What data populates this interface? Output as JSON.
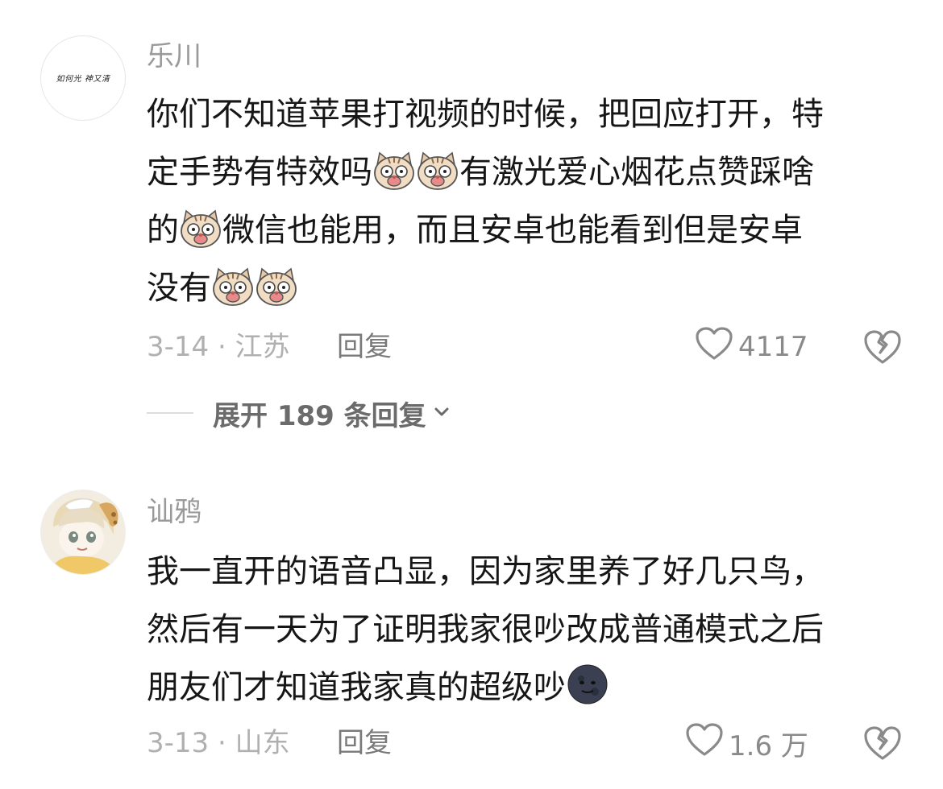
{
  "comments": [
    {
      "username": "乐川",
      "avatar_text": "如何光 神又清",
      "lines": [
        [
          {
            "t": "你们不知道苹果打视频的时候，把回应打开，特"
          }
        ],
        [
          {
            "t": "定手势有特效吗"
          },
          {
            "e": "cat-emoji"
          },
          {
            "e": "cat-emoji"
          },
          {
            "t": "有激光爱心烟花点赞踩啥"
          }
        ],
        [
          {
            "t": "的"
          },
          {
            "e": "cat-emoji"
          },
          {
            "t": "微信也能用，而且安卓也能看到但是安卓"
          }
        ],
        [
          {
            "t": "没有"
          },
          {
            "e": "cat-emoji"
          },
          {
            "e": "cat-emoji"
          }
        ]
      ],
      "date_location": "3-14 · 江苏",
      "reply_label": "回复",
      "like_count": "4117",
      "expand_label": "展开 189 条回复"
    },
    {
      "username": "讪鸦",
      "lines": [
        [
          {
            "t": "我一直开的语音凸显，因为家里养了好几只鸟，"
          }
        ],
        [
          {
            "t": "然后有一天为了证明我家很吵改成普通模式之后"
          }
        ],
        [
          {
            "t": "朋友们才知道我家真的超级吵"
          },
          {
            "e": "moon-emoji"
          }
        ]
      ],
      "date_location": "3-13 · 山东",
      "reply_label": "回复",
      "like_count": "1.6 万"
    }
  ],
  "icons": {
    "like": "heart-outline-icon",
    "dislike": "broken-heart-icon",
    "expand": "chevron-down-icon"
  },
  "colors": {
    "background": "#ffffff",
    "text": "#161616",
    "muted": "#9a9a9a",
    "accent_pink": "#e98a8a"
  }
}
